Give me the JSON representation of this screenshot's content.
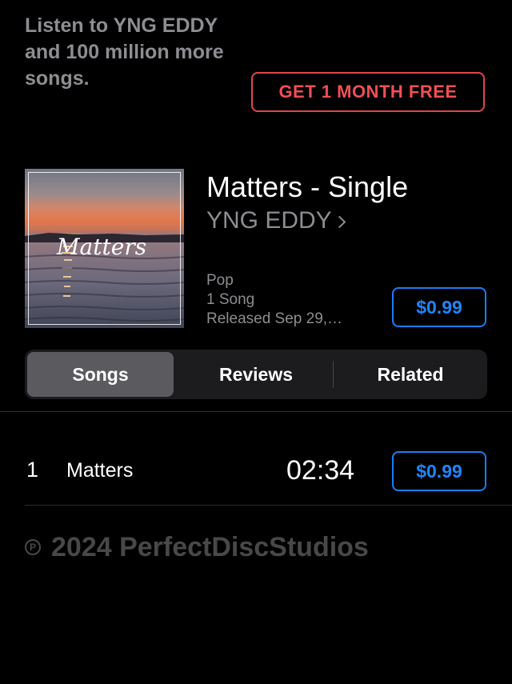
{
  "promo": {
    "text": "Listen to YNG EDDY and 100 million more songs.",
    "button_label": "GET 1 MONTH FREE"
  },
  "album": {
    "artwork_text": "Matters",
    "title": "Matters - Single",
    "artist": "YNG EDDY",
    "genre": "Pop",
    "song_count": "1 Song",
    "released": "Released Sep 29,…",
    "price": "$0.99"
  },
  "tabs": {
    "songs": "Songs",
    "reviews": "Reviews",
    "related": "Related",
    "selected": "Songs"
  },
  "tracks": [
    {
      "number": "1",
      "title": "Matters",
      "duration": "02:34",
      "price": "$0.99"
    }
  ],
  "footer": {
    "p_symbol": "P",
    "copyright": "2024 PerfectDiscStudios"
  },
  "colors": {
    "accent_blue": "#1f86ff",
    "promo_red": "#ef4f55",
    "secondary_text": "#8d8d92",
    "footer_text": "#48484a"
  }
}
